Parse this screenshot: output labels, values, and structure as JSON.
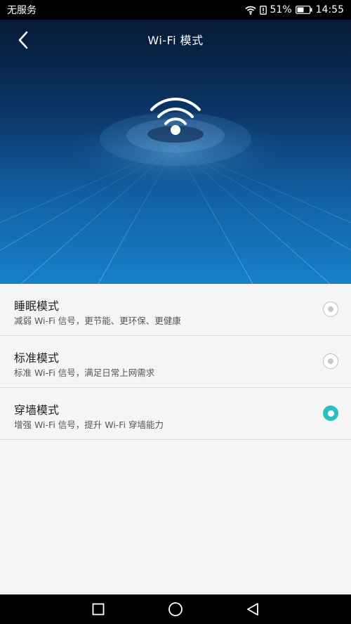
{
  "status_bar": {
    "carrier": "无服务",
    "battery": "51%",
    "time": "14:55"
  },
  "header": {
    "title": "Wi-Fi 模式",
    "back_icon": "chevron-left-icon"
  },
  "hero": {
    "icon": "wifi-icon"
  },
  "modes": [
    {
      "title": "睡眠模式",
      "description": "减弱 Wi-Fi 信号，更节能、更环保、更健康",
      "selected": false
    },
    {
      "title": "标准模式",
      "description": "标准 Wi-Fi 信号，满足日常上网需求",
      "selected": false
    },
    {
      "title": "穿墙模式",
      "description": "增强 Wi-Fi 信号，提升 Wi-Fi 穿墙能力",
      "selected": true
    }
  ],
  "colors": {
    "accent": "#2bbfbf",
    "hero_top": "#061a35",
    "hero_bottom": "#1780c9"
  },
  "nav_bar": {
    "icons": [
      "recent-apps-icon",
      "home-icon",
      "back-icon"
    ]
  }
}
